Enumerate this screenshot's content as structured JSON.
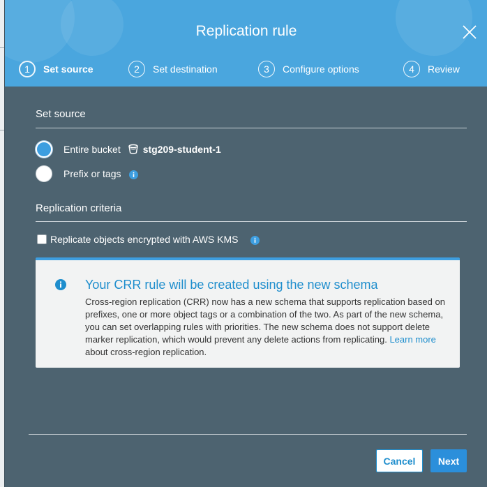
{
  "modal": {
    "title": "Replication rule"
  },
  "steps": [
    {
      "number": "1",
      "label": "Set source",
      "active": true
    },
    {
      "number": "2",
      "label": "Set destination",
      "active": false
    },
    {
      "number": "3",
      "label": "Configure options",
      "active": false
    },
    {
      "number": "4",
      "label": "Review",
      "active": false
    }
  ],
  "source": {
    "heading": "Set source",
    "option_entire_bucket": "Entire bucket",
    "bucket_name": "stg209-student-1",
    "option_prefix_tags": "Prefix or tags",
    "selected": "Entire bucket"
  },
  "criteria": {
    "heading": "Replication criteria",
    "kms_label": "Replicate objects encrypted with AWS KMS",
    "kms_checked": false
  },
  "notice": {
    "title": "Your CRR rule will be created using the new schema",
    "body_before_link": "Cross-region replication (CRR) now has a new schema that supports replication based on prefixes, one or more object tags or a combination of the two. As part of the new schema, you can set overlapping rules with priorities. The new schema does not support delete marker replication, which would prevent any delete actions from replicating. ",
    "link_text": "Learn more",
    "body_after_link": " about cross-region replication."
  },
  "footer": {
    "cancel_label": "Cancel",
    "next_label": "Next"
  },
  "colors": {
    "header": "#4aa6de",
    "body": "#4d6370",
    "accent": "#1f8ecd",
    "notice_bg": "#f2f3f3"
  },
  "icons": [
    "close-icon",
    "bucket-icon",
    "info-icon"
  ]
}
